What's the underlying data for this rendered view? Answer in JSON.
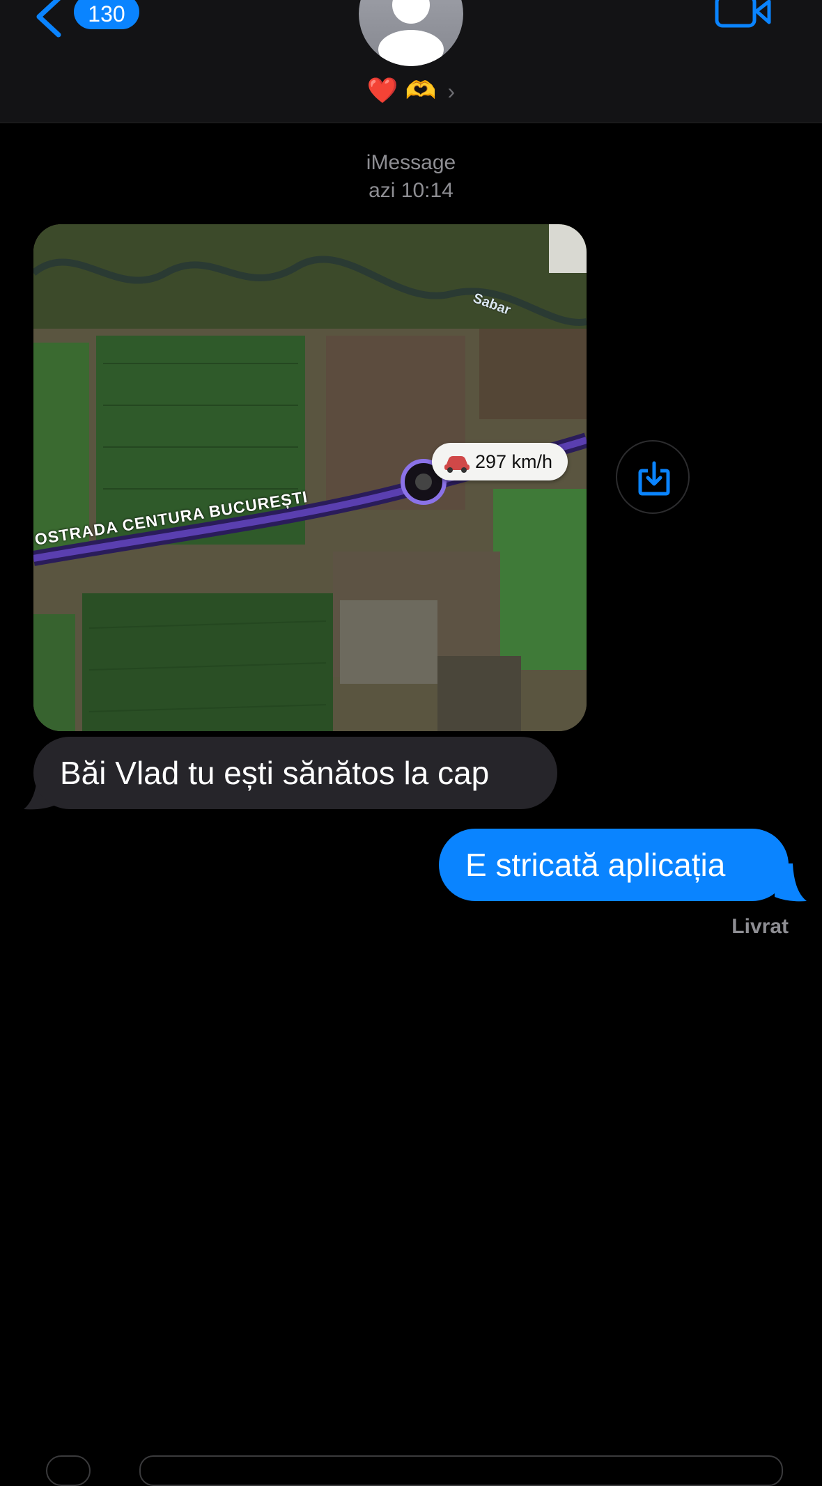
{
  "header": {
    "back_count": "130",
    "contact_name": "❤️ 🫶",
    "chevron": "›",
    "icons": {
      "back": "chevron-left-icon",
      "video": "video-camera-icon",
      "avatar": "person-silhouette-icon"
    },
    "accent_color": "#0a84ff"
  },
  "thread": {
    "service": "iMessage",
    "timestamp": "azi 10:14",
    "image_attachment": {
      "speed_label": "297 km/h",
      "road_label": "OSTRADA CENTURA BUCUREȘTI",
      "river_label": "Sabar",
      "save_icon": "download-tray-icon"
    },
    "messages": [
      {
        "direction": "incoming",
        "text": "Băi Vlad tu ești sănătos la cap"
      },
      {
        "direction": "outgoing",
        "text": "E stricată aplicația"
      }
    ],
    "delivery_status": "Livrat"
  },
  "colors": {
    "incoming_bubble": "#26252a",
    "outgoing_bubble": "#0a84ff",
    "background": "#000000"
  }
}
